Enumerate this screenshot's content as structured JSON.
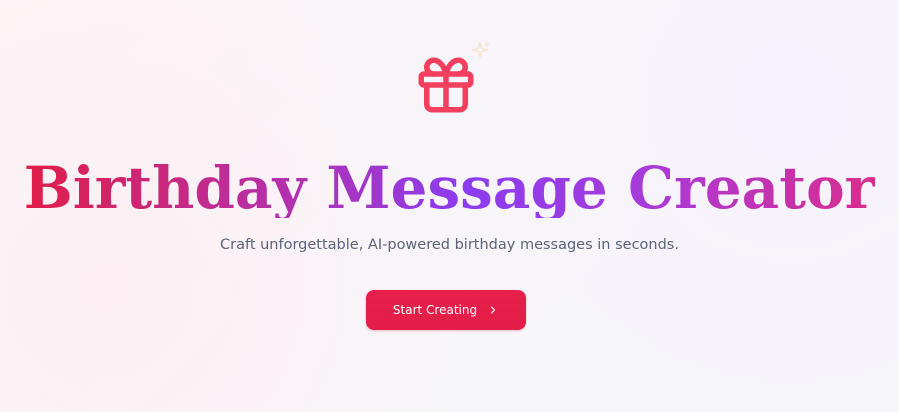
{
  "hero": {
    "title": "Birthday Message Creator",
    "subtitle": "Craft unforgettable, AI-powered birthday messages in seconds.",
    "cta_label": "Start Creating",
    "icon": "gift-icon",
    "decor_icon": "sparkle-icon",
    "cta_icon": "chevron-right-icon"
  },
  "colors": {
    "accent": "#e11d48",
    "title_gradient_start": "#e11d48",
    "title_gradient_mid": "#8b3cf0",
    "title_gradient_end": "#d92d8d",
    "subtitle": "#5b6478",
    "background": "#f7f6fa"
  }
}
